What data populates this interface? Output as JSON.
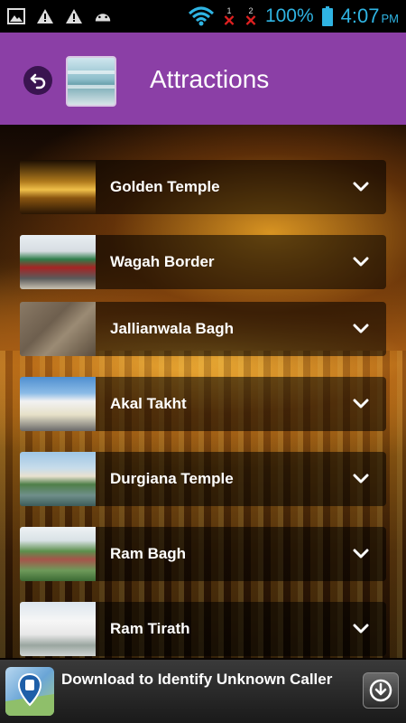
{
  "status_bar": {
    "battery_percent": "100%",
    "time": "4:07",
    "am_pm": "PM",
    "sim1_badge": "1",
    "sim2_badge": "2",
    "accent_color": "#2fb4e3"
  },
  "header": {
    "title": "Attractions",
    "background_color": "#8b3fa6"
  },
  "attractions": [
    {
      "name": "Golden Temple"
    },
    {
      "name": "Wagah Border"
    },
    {
      "name": "Jallianwala Bagh"
    },
    {
      "name": "Akal Takht"
    },
    {
      "name": "Durgiana Temple"
    },
    {
      "name": "Ram Bagh"
    },
    {
      "name": "Ram Tirath"
    }
  ],
  "ad": {
    "text": "Download to Identify Unknown Caller",
    "icon": "map-pin-icon",
    "action_icon": "download-icon"
  }
}
